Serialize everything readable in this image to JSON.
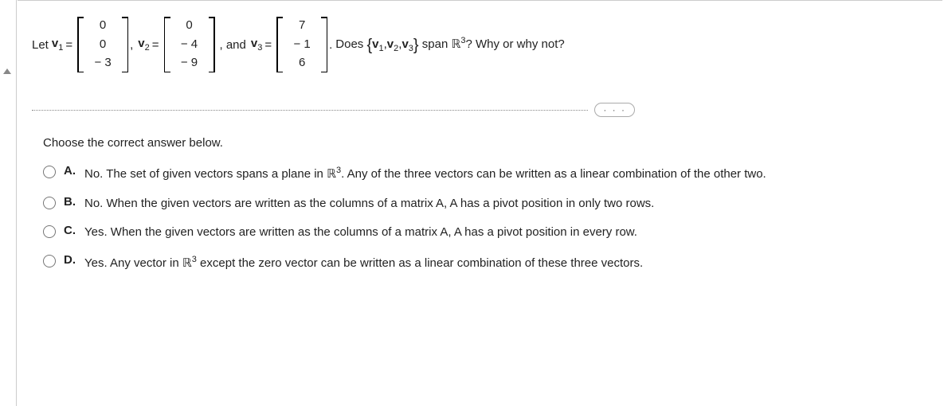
{
  "question": {
    "prefix": "Let",
    "v1_label": "v",
    "v1_sub": "1",
    "eq": "=",
    "v1": [
      "0",
      "0",
      "− 3"
    ],
    "comma": ",",
    "v2_label": "v",
    "v2_sub": "2",
    "v2": [
      "0",
      "− 4",
      "− 9"
    ],
    "and": ", and",
    "v3_label": "v",
    "v3_sub": "3",
    "v3": [
      "7",
      "− 1",
      "6"
    ],
    "period": ".",
    "tail_a": "Does ",
    "brace_l": "{",
    "set_v1": "v",
    "set_s1": "1",
    "set_c1": ",",
    "set_v2": "v",
    "set_s2": "2",
    "set_c2": ",",
    "set_v3": "v",
    "set_s3": "3",
    "brace_r": "}",
    "tail_b": " span ",
    "rset": "ℝ",
    "rsup": "3",
    "tail_c": "? Why or why not?"
  },
  "divider_dots": "· · ·",
  "instruction": "Choose the correct answer below.",
  "choices": {
    "A": {
      "label": "A.",
      "text_a": "No. The set of given vectors spans a plane in ",
      "r": "ℝ",
      "sup": "3",
      "text_b": ". Any of the three vectors can be written as a linear combination of the other two."
    },
    "B": {
      "label": "B.",
      "text": "No. When the given vectors are written as the columns of a matrix A, A has a pivot position in only two rows."
    },
    "C": {
      "label": "C.",
      "text": "Yes. When the given vectors are written as the columns of a matrix A, A has a pivot position in every row."
    },
    "D": {
      "label": "D.",
      "text_a": "Yes. Any vector in ",
      "r": "ℝ",
      "sup": "3",
      "text_b": " except the zero vector can be written as a linear combination of these three vectors."
    }
  }
}
